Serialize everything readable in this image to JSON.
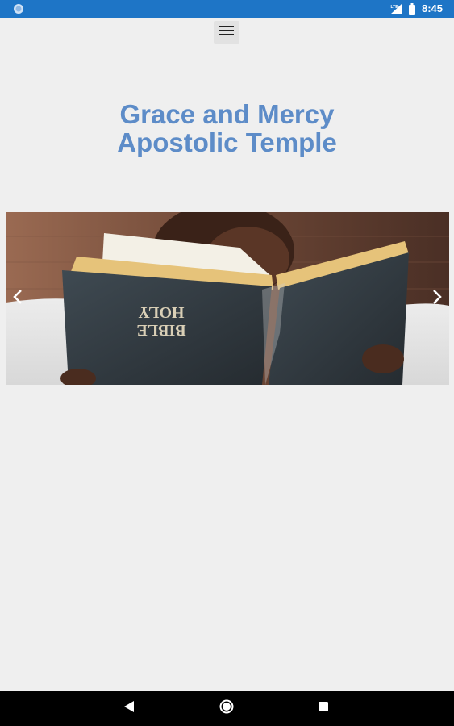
{
  "status_bar": {
    "time": "8:45",
    "icons": [
      "app-notification-icon",
      "signal-icon",
      "battery-icon"
    ]
  },
  "header": {
    "menu_icon": "hamburger-menu-icon",
    "title_line1": "Grace and Mercy",
    "title_line2": "Apostolic Temple"
  },
  "carousel": {
    "slide_image": "person-reading-holy-bible",
    "book_text_line1": "HOLY",
    "book_text_line2": "BIBLE",
    "prev_icon": "chevron-left-icon",
    "next_icon": "chevron-right-icon"
  },
  "nav_bar": {
    "buttons": [
      "back-icon",
      "home-icon",
      "recents-icon"
    ]
  },
  "colors": {
    "status_bar": "#1e75c6",
    "title": "#5d8cc8",
    "background": "#efefef",
    "nav_bar": "#000000"
  }
}
